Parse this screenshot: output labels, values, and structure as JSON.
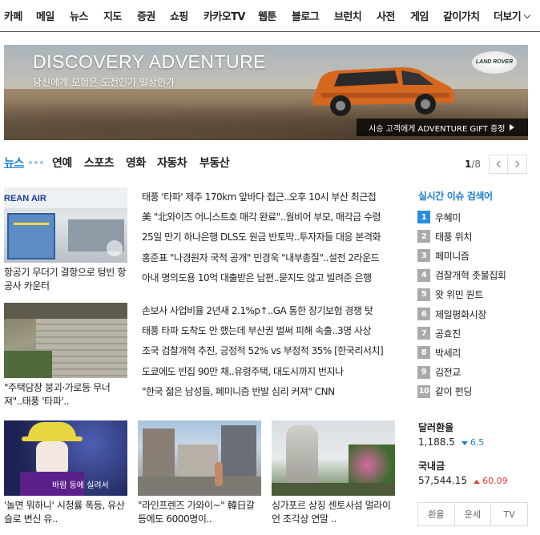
{
  "nav": {
    "items": [
      "카페",
      "메일",
      "뉴스",
      "지도",
      "증권",
      "쇼핑",
      "카카오TV",
      "웹툰",
      "블로그",
      "브런치",
      "사전",
      "게임",
      "같이가치"
    ],
    "more": "더보기"
  },
  "banner": {
    "title": "DISCOVERY ADVENTURE",
    "subtitle": "당신에게 모험은 도전인가 일상인가",
    "logo": "LAND ROVER",
    "gift": "시승 고객에게 ADVENTURE GIFT 증정"
  },
  "tabs": {
    "items": [
      "뉴스",
      "연예",
      "스포츠",
      "영화",
      "자동차",
      "부동산"
    ],
    "page_current": "1",
    "page_total": "/8"
  },
  "thumbs": [
    {
      "caption": "항공기 무더기 결항으로 텅빈 항공사 카운터",
      "sign": "REAN AIR"
    },
    {
      "caption": "\"주택담장 붕괴·가로등 무너져\"..태풍 '타파'.."
    },
    {
      "caption": "'놀면 뭐하니' 시청률 폭등, 유산슬로 변신 유..",
      "overlay": "바람 등에 실려서"
    },
    {
      "caption": "\"라인프렌즈 가와이~\" 韓日갈등에도 6000명이.."
    },
    {
      "caption": "싱가포르 상징 센토사섬 멀라이언 조각상 연말 .."
    }
  ],
  "headlines_a": [
    "태풍 '타파' 제주 170km 앞바다 접근..오후 10시 부산 최근접",
    "美 \"北와이즈 어니스트호 매각 완료\"..웜비어 부모, 매각금 수령",
    "25일 만기 하나은행 DLS도 원금 반토막..투자자들 대응 본격화",
    "홍준표 \"나경원자 국적 공개\" 민경욱 \"내부총질\"..설전 2라운드",
    "아내 명의도용 10억 대출받은 남편..묻지도 않고 빌려준 은행"
  ],
  "headlines_b": [
    "손보사 사업비율 2년새 2.1%p↑..GA 통한 장기보험 경쟁 탓",
    "태풍 타파 도착도 안 했는데 부산권 벌써 피해 속출..3명 사상",
    "조국 검찰개혁 추진, 긍정적 52% vs 부정적 35% [한국리서치]",
    "도쿄에도 빈집 90만 채..유령주택, 대도시까지 번지나",
    "\"한국 젊은 남성들, 페미니즘 반발 심리 커져\" CNN"
  ],
  "realtime": {
    "title": "실시간 이슈 검색어",
    "items": [
      {
        "rank": "1",
        "text": "우혜미"
      },
      {
        "rank": "2",
        "text": "태풍 위치"
      },
      {
        "rank": "3",
        "text": "페미니즘"
      },
      {
        "rank": "4",
        "text": "검찰개혁 촛불집회"
      },
      {
        "rank": "5",
        "text": "왓 위민 원트"
      },
      {
        "rank": "6",
        "text": "제일평화시장"
      },
      {
        "rank": "7",
        "text": "공효진"
      },
      {
        "rank": "8",
        "text": "박세리"
      },
      {
        "rank": "9",
        "text": "김전교"
      },
      {
        "rank": "10",
        "text": "같이 펀딩"
      }
    ]
  },
  "finance": {
    "fx_label": "달러환율",
    "fx_value": "1,188.5",
    "fx_change": "6.5",
    "gold_label": "국내금",
    "gold_value": "57,544.15",
    "gold_change": "60.09"
  },
  "tools": [
    "환율",
    "운세",
    "TV"
  ],
  "colors": {
    "accent": "#1a7fd1",
    "rank_first": "#2b8ce0",
    "rise": "#e0402b"
  }
}
